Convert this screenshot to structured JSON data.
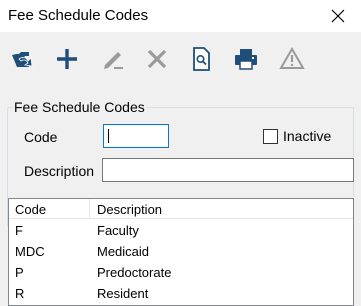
{
  "window": {
    "title": "Fee Schedule Codes"
  },
  "toolbar": {
    "buttons": [
      {
        "icon": "open-folder-icon",
        "enabled": true
      },
      {
        "icon": "add-icon",
        "enabled": true
      },
      {
        "icon": "edit-pencil-icon",
        "enabled": false
      },
      {
        "icon": "delete-icon",
        "enabled": false
      },
      {
        "icon": "preview-icon",
        "enabled": true
      },
      {
        "icon": "print-icon",
        "enabled": true
      },
      {
        "icon": "warning-icon",
        "enabled": false
      }
    ]
  },
  "form": {
    "group_title": "Fee Schedule Codes",
    "code_label": "Code",
    "code_value": "",
    "inactive_label": "Inactive",
    "inactive_checked": false,
    "description_label": "Description",
    "description_value": ""
  },
  "list": {
    "columns": [
      "Code",
      "Description"
    ],
    "rows": [
      {
        "code": "F",
        "description": "Faculty"
      },
      {
        "code": "MDC",
        "description": "Medicaid"
      },
      {
        "code": "P",
        "description": "Predoctorate"
      },
      {
        "code": "R",
        "description": "Resident"
      }
    ]
  },
  "colors": {
    "accent": "#0078d7",
    "icon_blue": "#1f4e79",
    "disabled": "#9a9a9a"
  }
}
